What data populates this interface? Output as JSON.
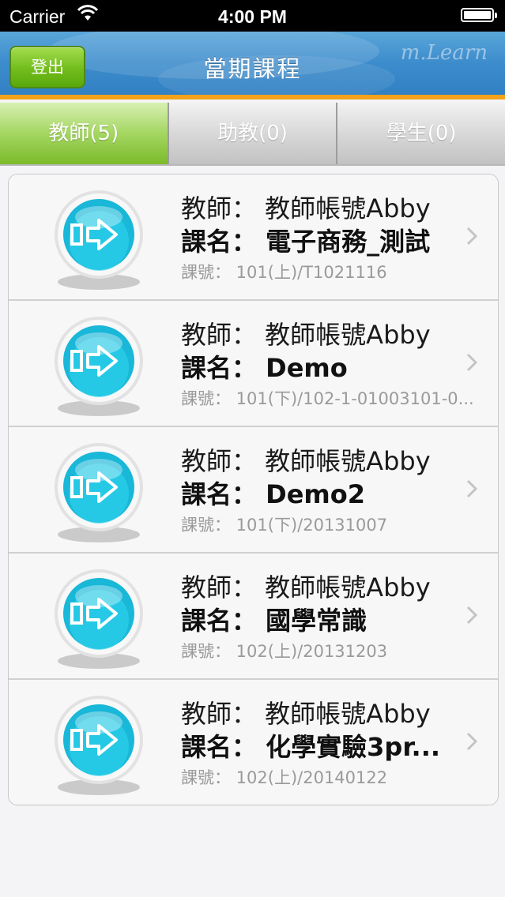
{
  "status_bar": {
    "carrier": "Carrier",
    "time": "4:00 PM"
  },
  "nav": {
    "logout_label": "登出",
    "title": "當期課程",
    "brand_watermark": "m.Learn"
  },
  "tabs": [
    {
      "label": "教師(5)",
      "active": true
    },
    {
      "label": "助教(0)",
      "active": false
    },
    {
      "label": "學生(0)",
      "active": false
    }
  ],
  "courses": [
    {
      "teacher": "教師：  教師帳號Abby",
      "name": "課名：  電子商務_測試",
      "code": "課號：  101(上)/T1021116"
    },
    {
      "teacher": "教師：  教師帳號Abby",
      "name": "課名：  Demo",
      "code": "課號：  101(下)/102-1-01003101-0..."
    },
    {
      "teacher": "教師：  教師帳號Abby",
      "name": "課名：  Demo2",
      "code": "課號：  101(下)/20131007"
    },
    {
      "teacher": "教師：  教師帳號Abby",
      "name": "課名：  國學常識",
      "code": "課號：  102(上)/20131203"
    },
    {
      "teacher": "教師：  教師帳號Abby",
      "name": "課名：  化學實驗3pr...",
      "code": "課號：  102(上)/20140122"
    }
  ],
  "colors": {
    "accent_green": "#7bbb2a",
    "nav_blue": "#3d8ccc",
    "nav_orange": "#f4a21a",
    "icon_cyan": "#1ec8e6"
  }
}
